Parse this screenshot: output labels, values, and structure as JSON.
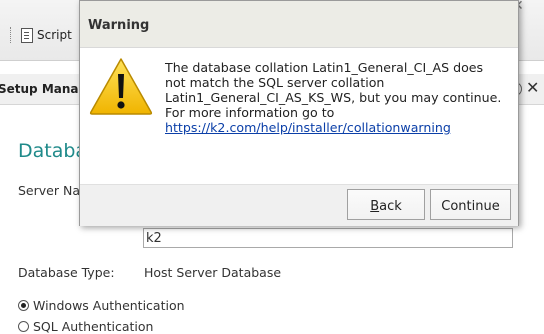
{
  "background": {
    "toolbar": {
      "script_label": "Script"
    },
    "setup_title": "Setup Manag",
    "help_icon": "?",
    "section_title": "Databas",
    "server_name_label": "Server Na",
    "instance_value": "k2",
    "database_type_label": "Database Type:",
    "database_type_value": "Host Server Database",
    "auth_options": [
      {
        "label": "Windows Authentication",
        "selected": true
      },
      {
        "label": "SQL Authentication",
        "selected": false
      }
    ]
  },
  "dialog": {
    "title": "Warning",
    "icon": "warning-triangle-icon",
    "message": "The database collation Latin1_General_CI_AS does not match the SQL server collation Latin1_General_CI_AS_KS_WS, but you may continue. For more information go to",
    "link": "https://k2.com/help/installer/collationwarning",
    "buttons": {
      "back": "Back",
      "continue": "Continue"
    }
  },
  "colors": {
    "accent_title": "#1f8a8a",
    "link": "#0b3fa8",
    "warning_yellow": "#f5c400"
  }
}
